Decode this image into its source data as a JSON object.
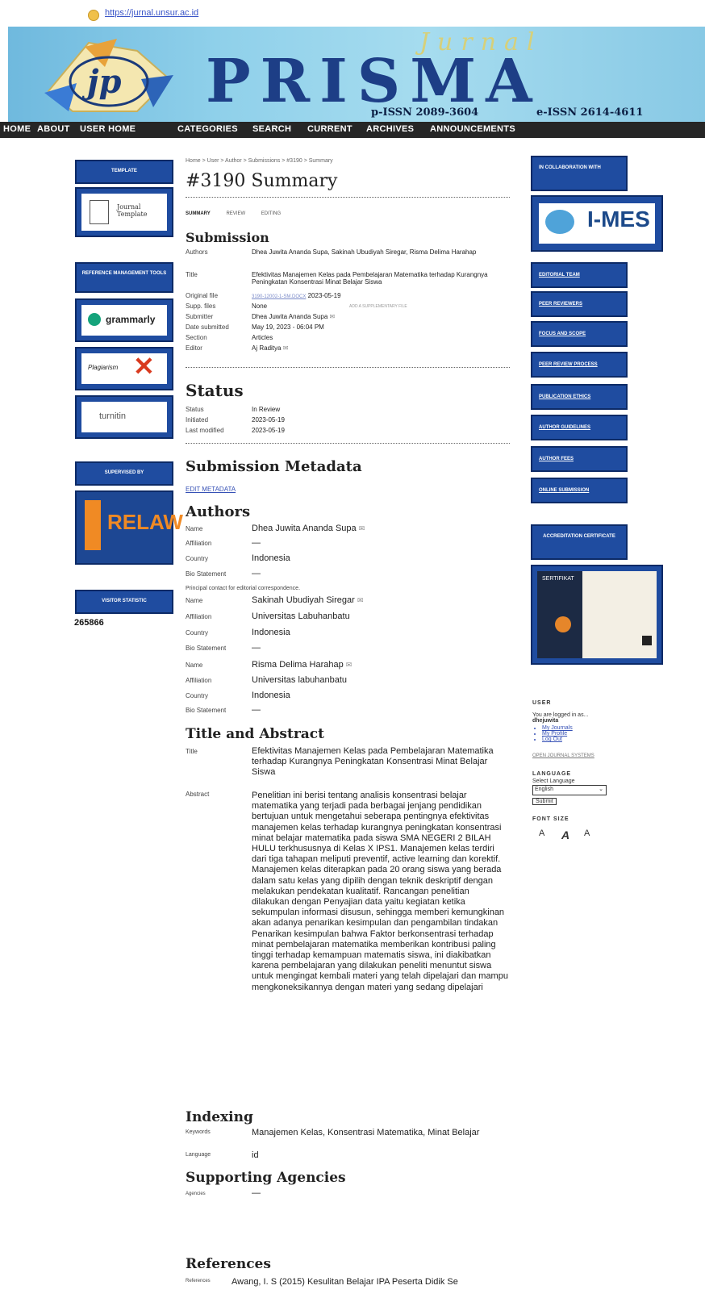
{
  "browser": {
    "url": "https://jurnal.unsur.ac.id"
  },
  "header": {
    "journal_word": "Jurnal",
    "name": "PRISMA",
    "p_issn": "p-ISSN 2089-3604",
    "e_issn": "e-ISSN 2614-4611",
    "logo_text": "jp"
  },
  "nav": [
    "HOME",
    "ABOUT",
    "USER HOME",
    "CATEGORIES",
    "SEARCH",
    "CURRENT",
    "ARCHIVES",
    "ANNOUNCEMENTS"
  ],
  "left_sidebar": {
    "template_label": "TEMPLATE",
    "journal_template": "Journal Template",
    "ref_tools_label": "REFERENCE MANAGEMENT TOOLS",
    "grammarly": "grammarly",
    "plagiarism": "Plagiarism",
    "turnitin": "turnitin",
    "supervised_label": "SUPERVISED BY",
    "relawan": "RELAW",
    "visitor_label": "VISITOR STATISTIC",
    "visitor_count": "265866"
  },
  "breadcrumb": "Home > User > Author > Submissions > #3190 > Summary",
  "page_title": "#3190 Summary",
  "tabs": [
    "SUMMARY",
    "REVIEW",
    "EDITING"
  ],
  "submission": {
    "heading": "Submission",
    "authors_label": "Authors",
    "authors": "Dhea Juwita Ananda Supa, Sakinah Ubudiyah Siregar, Risma Delima Harahap",
    "title_label": "Title",
    "title": "Efektivitas Manajemen Kelas pada Pembelajaran Matematika terhadap Kurangnya Peningkatan Konsentrasi Minat Belajar Siswa",
    "original_label": "Original file",
    "original_file": "3190-12002-1-SM.DOCX",
    "original_date": "2023-05-19",
    "supp_label": "Supp. files",
    "supp_value": "None",
    "supp_link": "ADD A SUPPLEMENTARY FILE",
    "submitter_label": "Submitter",
    "submitter": "Dhea Juwita Ananda Supa",
    "date_label": "Date submitted",
    "date": "May 19, 2023 - 06:04 PM",
    "section_label": "Section",
    "section": "Articles",
    "editor_label": "Editor",
    "editor": "Aj Raditya"
  },
  "status": {
    "heading": "Status",
    "status_label": "Status",
    "status": "In Review",
    "initiated_label": "Initiated",
    "initiated": "2023-05-19",
    "modified_label": "Last modified",
    "modified": "2023-05-19"
  },
  "metadata": {
    "heading": "Submission Metadata",
    "edit_link": "EDIT METADATA",
    "authors_heading": "Authors",
    "labels": {
      "name": "Name",
      "affiliation": "Affiliation",
      "country": "Country",
      "bio": "Bio Statement"
    },
    "authors": [
      {
        "name": "Dhea Juwita Ananda Supa",
        "affiliation": "—",
        "country": "Indonesia",
        "bio": "—"
      },
      {
        "name": "Sakinah Ubudiyah Siregar",
        "affiliation": "Universitas Labuhanbatu",
        "country": "Indonesia",
        "bio": "—"
      },
      {
        "name": "Risma Delima Harahap",
        "affiliation": "Universitas labuhanbatu",
        "country": "Indonesia",
        "bio": "—"
      }
    ],
    "principal_contact": "Principal contact for editorial correspondence."
  },
  "title_abstract": {
    "heading": "Title and Abstract",
    "title_label": "Title",
    "title": "Efektivitas Manajemen Kelas pada Pembelajaran Matematika terhadap Kurangnya Peningkatan Konsentrasi Minat Belajar Siswa",
    "abstract_label": "Abstract",
    "abstract": "Penelitian ini berisi tentang analisis konsentrasi belajar matematika yang terjadi pada berbagai jenjang pendidikan bertujuan untuk mengetahui seberapa pentingnya efektivitas manajemen kelas terhadap kurangnya peningkatan konsentrasi minat belajar matematika pada siswa SMA NEGERI 2 BILAH HULU terkhususnya di Kelas X IPS1. Manajemen kelas terdiri dari tiga tahapan meliputi preventif, active learning dan korektif. Manajemen kelas diterapkan pada 20 orang siswa yang berada dalam satu kelas yang dipilih dengan teknik deskriptif dengan melakukan pendekatan kualitatif. Rancangan penelitian dilakukan dengan Penyajian data yaitu kegiatan ketika sekumpulan informasi disusun, sehingga memberi kemungkinan akan adanya penarikan kesimpulan dan pengambilan tindakan Penarikan kesimpulan bahwa Faktor berkonsentrasi terhadap minat pembelajaran matematika memberikan kontribusi paling tinggi terhadap kemampuan matematis siswa, ini diakibatkan karena pembelajaran yang dilakukan peneliti menuntut siswa untuk mengingat kembali materi yang telah dipelajari dan mampu mengkoneksikannya dengan materi yang sedang dipelajari"
  },
  "indexing": {
    "heading": "Indexing",
    "keywords_label": "Keywords",
    "keywords": "Manajemen Kelas, Konsentrasi Matematika, Minat Belajar",
    "language_label": "Language",
    "language": "id"
  },
  "agencies": {
    "heading": "Supporting Agencies",
    "label": "Agencies",
    "value": "—"
  },
  "references": {
    "heading": "References",
    "label": "References",
    "value": "Awang, I. S (2015) Kesulitan Belajar IPA Peserta Didik Se"
  },
  "right_sidebar": {
    "collab_label": "IN COLLABORATION WITH",
    "imes": "I-MES",
    "links": [
      "EDITORIAL TEAM",
      "PEER REVIEWERS",
      "FOCUS AND SCOPE",
      "PEER REVIEW PROCESS",
      "PUBLICATION ETHICS",
      "AUTHOR GUIDELINES",
      "AUTHOR FEES",
      "ONLINE SUBMISSION"
    ],
    "accreditation_label": "ACCREDITATION CERTIFICATE",
    "sertifikat": "SERTIFIKAT"
  },
  "user_block": {
    "heading": "USER",
    "logged_in_as": "You are logged in as...",
    "username": "dhejuwita",
    "links": [
      "My Journals",
      "My Profile",
      "Log Out"
    ],
    "ojs": "OPEN JOURNAL SYSTEMS",
    "language_heading": "LANGUAGE",
    "select_language": "Select Language",
    "language_value": "English",
    "submit": "Submit",
    "font_size_heading": "FONT SIZE",
    "font_small": "A",
    "font_medium": "A",
    "font_large": "A"
  }
}
